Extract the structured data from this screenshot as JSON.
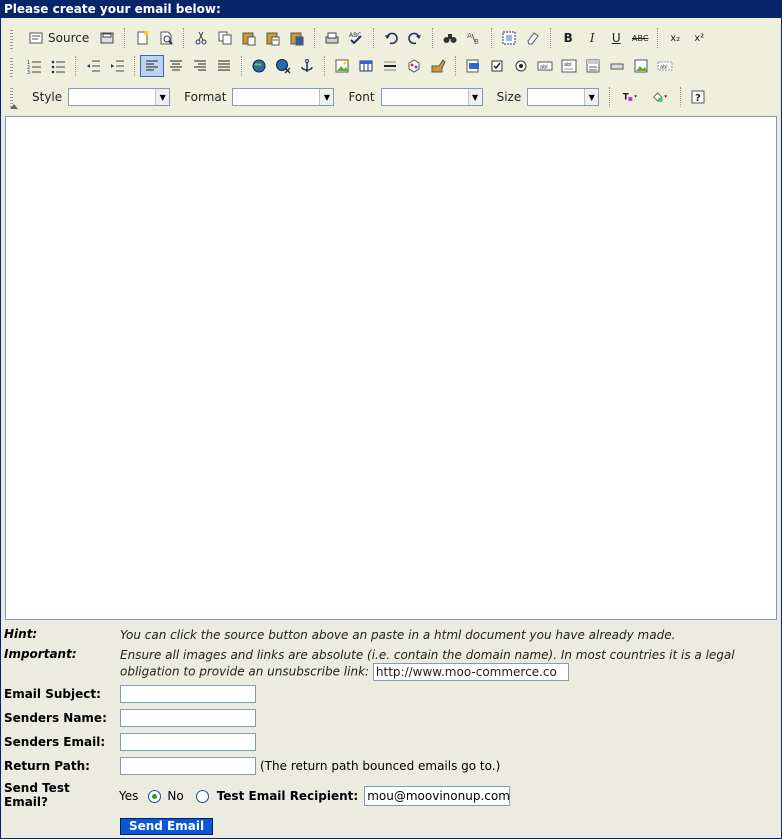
{
  "title": "Please create your email below:",
  "toolbar": {
    "source_label": "Source",
    "style_label": "Style",
    "format_label": "Format",
    "font_label": "Font",
    "size_label": "Size",
    "bold": "B",
    "italic": "I",
    "underline": "U",
    "strike": "ABC",
    "subscript": "x₂",
    "superscript": "x²",
    "style_value": "",
    "format_value": "",
    "font_value": "",
    "size_value": ""
  },
  "form": {
    "hint_label": "Hint:",
    "hint_text": "You can click the source button above an paste in a html document you have already made.",
    "important_label": "Important:",
    "important_text_1": "Ensure all images and links are absolute (i.e. contain the domain name). In most countries it is a legal",
    "important_text_2": "obligation to provide an unsubscribe link:",
    "unsubscribe_link": "http://www.moo-commerce.co",
    "subject_label": "Email Subject:",
    "subject_value": "",
    "senders_name_label": "Senders Name:",
    "senders_name_value": "",
    "senders_email_label": "Senders Email:",
    "senders_email_value": "",
    "return_path_label": "Return Path:",
    "return_path_value": "",
    "return_path_note": "(The return path bounced emails go to.)",
    "send_test_label_1": "Send Test",
    "send_test_label_2": "Email?",
    "yes_label": "Yes",
    "no_label": "No",
    "test_recipient_label": "Test Email Recipient:",
    "test_recipient_value": "mou@moovinonup.com",
    "send_button": "Send Email",
    "test_selected": "yes"
  }
}
